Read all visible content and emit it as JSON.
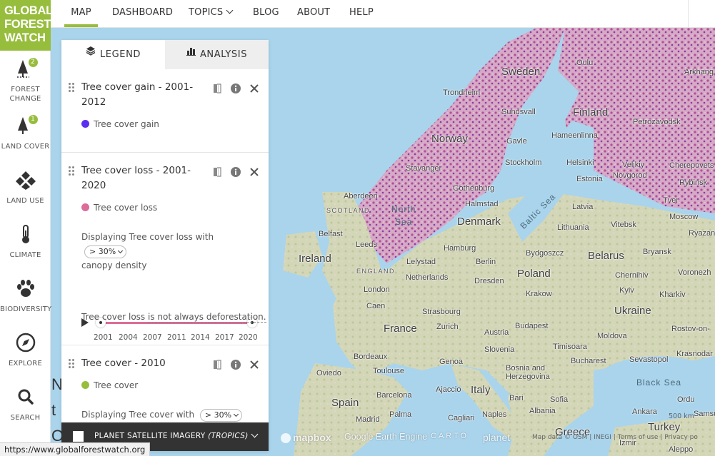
{
  "logo": {
    "lines": [
      "GLOBAL",
      "FOREST",
      "WATCH"
    ]
  },
  "nav": {
    "items": [
      {
        "label": "MAP"
      },
      {
        "label": "DASHBOARD"
      },
      {
        "label": "TOPICS"
      },
      {
        "label": "BLOG"
      },
      {
        "label": "ABOUT"
      },
      {
        "label": "HELP"
      }
    ]
  },
  "sidebar": {
    "items": [
      {
        "label": "FOREST CHANGE",
        "badge": "2"
      },
      {
        "label": "LAND COVER",
        "badge": "1"
      },
      {
        "label": "LAND USE"
      },
      {
        "label": "CLIMATE"
      },
      {
        "label": "BIODIVERSITY"
      },
      {
        "label": "EXPLORE"
      },
      {
        "label": "SEARCH"
      }
    ]
  },
  "panel": {
    "tabs": [
      {
        "label": "LEGEND"
      },
      {
        "label": "ANALYSIS"
      }
    ],
    "layers": [
      {
        "title": "Tree cover gain - 2001-2012",
        "legend_label": "Tree cover gain",
        "color": "#5a2ff0"
      },
      {
        "title": "Tree cover loss - 2001-2020",
        "legend_label": "Tree cover loss",
        "color": "#dc6c9a",
        "canopy_prefix": "Displaying Tree cover loss with",
        "canopy_value": "> 30%",
        "canopy_suffix": "canopy density",
        "years": [
          "2001",
          "2004",
          "2007",
          "2011",
          "2014",
          "2017",
          "2020"
        ],
        "note_prefix": "Tree cover loss ",
        "note_link": "is not always deforestation."
      },
      {
        "title": "Tree cover - 2010",
        "legend_label": "Tree cover",
        "color": "#97bd3d",
        "canopy_prefix": "Displaying Tree cover with",
        "canopy_value": "> 30%"
      }
    ],
    "planet": {
      "label": "PLANET SATELLITE IMAGERY",
      "label_em": "(TROPICS)"
    }
  },
  "map": {
    "countries": [
      "Sweden",
      "Finland",
      "Norway",
      "Denmark",
      "Ireland",
      "France",
      "Spain",
      "Italy",
      "Poland",
      "Belarus",
      "Ukraine",
      "Turkey",
      "Greece",
      "Lithuania",
      "Latvia",
      "Estonia"
    ],
    "seas": [
      "North",
      "Sea",
      "Baltic Sea",
      "Black Sea"
    ],
    "regions": [
      "SCOTLAND",
      "ENGLAND"
    ],
    "cities": [
      "Oulu",
      "Arkhang",
      "Sundsvall",
      "Trondheim",
      "Petrozavodsk",
      "Hameenlinna",
      "Gavle",
      "Helsinki",
      "Velikiy",
      "Novgorod",
      "Cherepovets",
      "Stavanger",
      "Stockholm",
      "Rybinsk",
      "Aberdeen",
      "Gothenburg",
      "Tver",
      "Halmstad",
      "Moscow",
      "Vitebsk",
      "Ryazan",
      "Belfast",
      "Leeds",
      "Hamburg",
      "Bydgoszcz",
      "Bryansk",
      "Lelystad",
      "Berlin",
      "Voronezh",
      "Chernihiv",
      "Netherlands",
      "Dresden",
      "London",
      "Kyiv",
      "Krakow",
      "Kharkiv",
      "Caen",
      "Strasbourg",
      "Rostov-on-",
      "Zurich",
      "Budapest",
      "Austria",
      "Moldova",
      "Timisoara",
      "Slovenia",
      "Krasnodar",
      "Bordeaux",
      "Genoa",
      "Bucharest",
      "Bosnia and",
      "Herzegovina",
      "Sevastopol",
      "Toulouse",
      "Oviedo",
      "Ajaccio",
      "Barcelona",
      "Bari",
      "Sofia",
      "Ordu",
      "Madrid",
      "Palma",
      "Naples",
      "Albania",
      "Samsun",
      "Ankara",
      "Cagliari",
      "Izmir",
      "Aleppo"
    ],
    "edge_letters": [
      "N",
      "t",
      "O"
    ],
    "attribution": {
      "mapbox": "mapbox",
      "google": "Google Earth Engine",
      "carto": "CARTO",
      "planet": "planet",
      "small": "Map data © OSM | INEGI | Terms of use | Privacy po",
      "scale": "500 km"
    }
  },
  "status_url": "https://www.globalforestwatch.org"
}
